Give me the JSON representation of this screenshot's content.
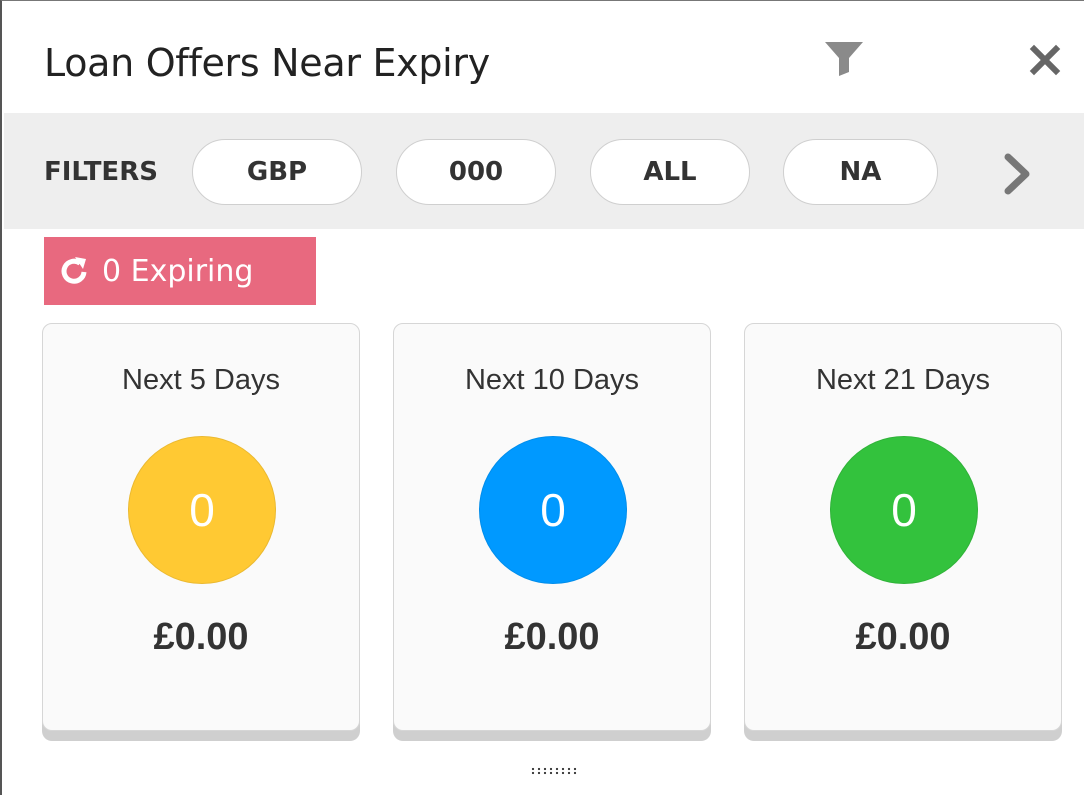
{
  "widget": {
    "title": "Loan Offers Near Expiry",
    "filter_icon": "filter-icon",
    "close_icon": "close-icon"
  },
  "filters": {
    "label": "FILTERS",
    "chips": [
      "GBP",
      "000",
      "ALL",
      "NA"
    ],
    "next_icon": "chevron-right-icon"
  },
  "expiring": {
    "icon": "refresh-icon",
    "label": "0 Expiring",
    "color": "#e8697f"
  },
  "cards": [
    {
      "label": "Next 5 Days",
      "count": "0",
      "amount": "£0.00",
      "color": "#ffc933"
    },
    {
      "label": "Next 10 Days",
      "count": "0",
      "amount": "£0.00",
      "color": "#0099ff"
    },
    {
      "label": "Next 21 Days",
      "count": "0",
      "amount": "£0.00",
      "color": "#33c23d"
    }
  ]
}
